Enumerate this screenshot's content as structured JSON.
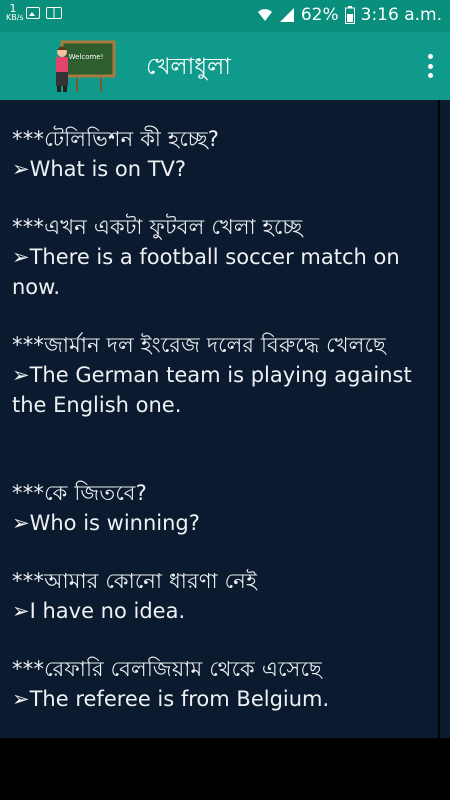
{
  "status_bar": {
    "speed_value": "1",
    "speed_unit": "KB/s",
    "battery": "62%",
    "time": "3:16 a.m."
  },
  "app_bar": {
    "title": "খেলাধুলা",
    "logo_text": "Welcome!"
  },
  "entries": [
    {
      "bengali": "***টেলিভিশন কী হচ্ছে?",
      "english": "➢What is on TV?"
    },
    {
      "bengali": "***এখন একটা ফুটবল খেলা হচ্ছে",
      "english": "➢There is a football soccer match on now."
    },
    {
      "bengali": "***জার্মান দল ইংরেজ দলের বিরুদ্ধে খেলছে",
      "english": "➢The German team is playing against the English one."
    },
    {
      "bengali": "***কে জিতবে?",
      "english": "➢Who is winning?"
    },
    {
      "bengali": "***আমার কোনো ধারণা নেই",
      "english": "➢I have no idea."
    },
    {
      "bengali": "***রেফারি বেলজিয়াম থেকে এসেছে",
      "english": "➢The referee is from Belgium."
    }
  ]
}
